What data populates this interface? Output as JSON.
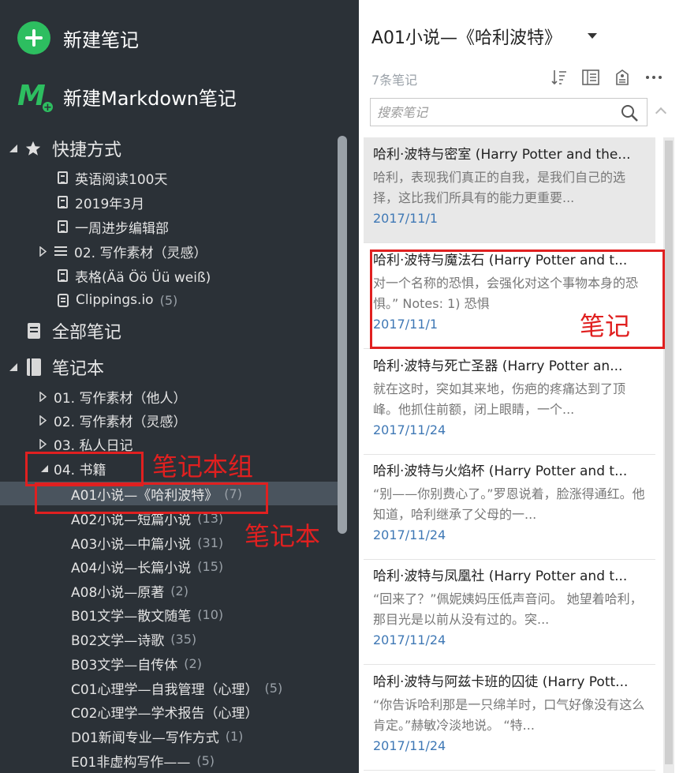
{
  "sidebar": {
    "new_note": "新建笔记",
    "new_markdown": "新建Markdown笔记",
    "shortcuts_label": "快捷方式",
    "shortcuts": [
      {
        "label": "英语阅读100天",
        "count": ""
      },
      {
        "label": "2019年3月",
        "count": ""
      },
      {
        "label": "一周进步编辑部",
        "count": ""
      },
      {
        "label": "02. 写作素材（灵感）",
        "count": ""
      },
      {
        "label": "表格(Ää Öö Üü weiß)",
        "count": ""
      },
      {
        "label": "Clippings.io",
        "count": "(5)"
      }
    ],
    "all_notes_label": "全部笔记",
    "notebooks_label": "笔记本",
    "notebooks": [
      {
        "label": "01. 写作素材（他人）",
        "count": ""
      },
      {
        "label": "02. 写作素材（灵感）",
        "count": ""
      },
      {
        "label": "03. 私人日记",
        "count": ""
      },
      {
        "label": "04. 书籍",
        "count": ""
      },
      {
        "label": "A01小说—《哈利波特》",
        "count": "(7)"
      },
      {
        "label": "A02小说—短篇小说",
        "count": "(13)"
      },
      {
        "label": "A03小说—中篇小说",
        "count": "(31)"
      },
      {
        "label": "A04小说—长篇小说",
        "count": "(15)"
      },
      {
        "label": "A08小说—原著",
        "count": "(2)"
      },
      {
        "label": "B01文学—散文随笔",
        "count": "(10)"
      },
      {
        "label": "B02文学—诗歌",
        "count": "(35)"
      },
      {
        "label": "B03文学—自传体",
        "count": "(2)"
      },
      {
        "label": "C01心理学—自我管理（心理）",
        "count": "(5)"
      },
      {
        "label": "C02心理学—学术报告（心理）",
        "count": ""
      },
      {
        "label": "D01新闻专业—写作方式",
        "count": "(1)"
      },
      {
        "label": "E01非虚构写作——",
        "count": "(5)"
      }
    ]
  },
  "annotations": {
    "notebook_group": "笔记本组",
    "notebook": "笔记本",
    "note": "笔记"
  },
  "main": {
    "notebook_title": "A01小说—《哈利波特》",
    "note_count": "7条笔记",
    "search_placeholder": "搜索笔记",
    "notes": [
      {
        "title": "哈利·波特与密室 (Harry Potter and the...",
        "snippet": "哈利，表现我们真正的自我，是我们自己的选择，这比我们所具有的能力更重要...",
        "date": "2017/11/1"
      },
      {
        "title": "哈利·波特与魔法石 (Harry Potter and t...",
        "snippet": "对一个名称的恐惧，会强化对这个事物本身的恐惧。”   Notes: 1) 恐惧",
        "date": "2017/11/1"
      },
      {
        "title": "哈利·波特与死亡圣器 (Harry Potter an...",
        "snippet": "就在这时，突如其来地，伤疤的疼痛达到了顶峰。他抓住前额，闭上眼睛，一个...",
        "date": "2017/11/24"
      },
      {
        "title": "哈利·波特与火焰杯 (Harry Potter and t...",
        "snippet": "“别——你别费心了。”罗恩说着，脸涨得通红。他知道，哈利继承了父母的一...",
        "date": "2017/11/24"
      },
      {
        "title": "哈利·波特与凤凰社 (Harry Potter and t...",
        "snippet": "“回来了？”佩妮姨妈压低声音问。 她望着哈利，那目光是以前从没有过的。突...",
        "date": "2017/11/24"
      },
      {
        "title": "哈利·波特与阿兹卡班的囚徒 (Harry Pott...",
        "snippet": "“你告诉哈利那是一只绵羊时，口气好像没有这么肯定。”赫敏冷淡地说。 “特...",
        "date": "2017/11/24"
      }
    ]
  },
  "colors": {
    "sidebar_bg": "#2b3137",
    "accent_green": "#2dbe60",
    "annotation_red": "#e02020",
    "date_blue": "#3f78b5"
  }
}
